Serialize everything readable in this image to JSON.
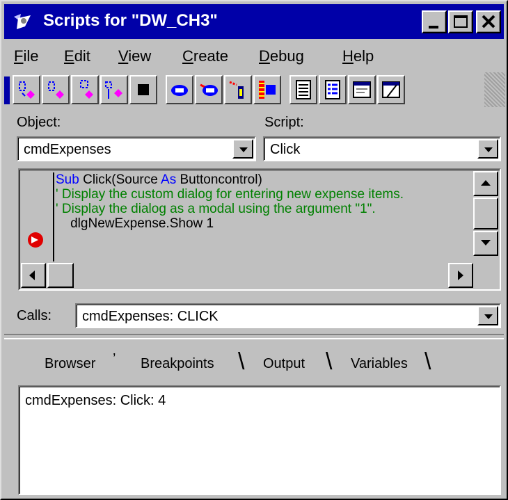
{
  "window": {
    "title": "Scripts for \"DW_CH3\""
  },
  "menu": [
    {
      "label": "File",
      "u": "F",
      "rest": "ile"
    },
    {
      "label": "Edit",
      "u": "E",
      "rest": "dit"
    },
    {
      "label": "View",
      "u": "V",
      "rest": "iew"
    },
    {
      "label": "Create",
      "u": "C",
      "rest": "reate"
    },
    {
      "label": "Debug",
      "u": "D",
      "rest": "ebug"
    },
    {
      "label": "Help",
      "u": "H",
      "rest": "elp"
    }
  ],
  "toolbar": {
    "icons": [
      "step-into-icon",
      "step-over-icon",
      "step-out-icon",
      "run-to-icon",
      "stop-icon",
      "browse-objects-icon",
      "browse-scripts-icon",
      "toggle-breakpoint-icon",
      "clear-breakpoints-icon",
      "calls-window-icon",
      "variables-window-icon",
      "output-window-icon",
      "browser-window-icon"
    ]
  },
  "object": {
    "label": "Object:",
    "value": "cmdExpenses"
  },
  "script": {
    "label": "Script:",
    "value": "Click"
  },
  "code": {
    "line1_kw1": "Sub",
    "line1_a": " Click(Source ",
    "line1_kw2": "As",
    "line1_b": " Buttoncontrol)",
    "line2": "' Display the custom dialog for entering new expense items.",
    "line3": "' Display the dialog as a modal using the argument \"1\".",
    "line4": "    dlgNewExpense.Show 1"
  },
  "calls": {
    "label": "Calls:",
    "value": "cmdExpenses: CLICK"
  },
  "tabs": [
    "Browser",
    "Breakpoints",
    "Output",
    "Variables"
  ],
  "output": {
    "text": "cmdExpenses: Click: 4"
  },
  "colors": {
    "titlebar": "#0000a8",
    "keyword": "#0000ff",
    "comment": "#008000",
    "breakpoint": "#e00000"
  }
}
